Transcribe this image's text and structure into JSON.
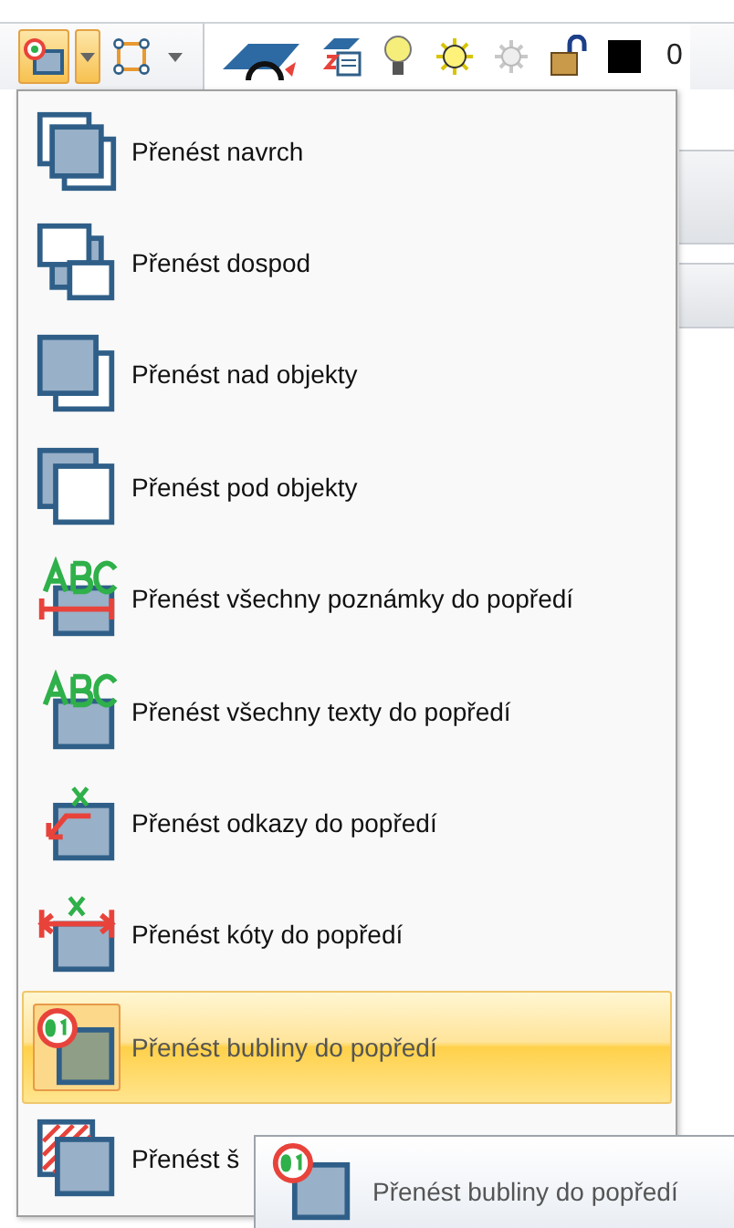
{
  "toolbar": {
    "groups": [
      {
        "buttons": [
          {
            "kind": "bubble",
            "selected": true
          },
          {
            "kind": "caret",
            "selected": true
          },
          {
            "kind": "frame",
            "selected": false
          },
          {
            "kind": "caret",
            "selected": false
          }
        ]
      },
      {
        "buttons": [
          {
            "kind": "plane",
            "selected": false
          },
          {
            "kind": "layers",
            "selected": false
          },
          {
            "kind": "bulb",
            "selected": false
          },
          {
            "kind": "sun",
            "selected": false
          },
          {
            "kind": "dimsun",
            "selected": false
          },
          {
            "kind": "lock",
            "selected": false
          },
          {
            "kind": "swatch",
            "selected": false
          }
        ],
        "value": "0"
      }
    ]
  },
  "menu": {
    "items": [
      {
        "label": "Přenést navrch",
        "kind": "front",
        "selected": false
      },
      {
        "label": "Přenést dospod",
        "kind": "back",
        "selected": false
      },
      {
        "label": "Přenést nad objekty",
        "kind": "above",
        "selected": false
      },
      {
        "label": "Přenést pod objekty",
        "kind": "below",
        "selected": false
      },
      {
        "label": "Přenést všechny poznámky do popředí",
        "kind": "notes",
        "selected": false
      },
      {
        "label": "Přenést všechny texty do popředí",
        "kind": "texts",
        "selected": false
      },
      {
        "label": "Přenést odkazy do popředí",
        "kind": "leaders",
        "selected": false
      },
      {
        "label": "Přenést kóty do popředí",
        "kind": "dims",
        "selected": false
      },
      {
        "label": "Přenést bubliny do popředí",
        "kind": "bubbles",
        "selected": true
      },
      {
        "label": "Přenést š",
        "kind": "hatch",
        "selected": false
      }
    ]
  },
  "tooltip": {
    "label": "Přenést bubliny do popředí",
    "kind": "bubbles"
  }
}
